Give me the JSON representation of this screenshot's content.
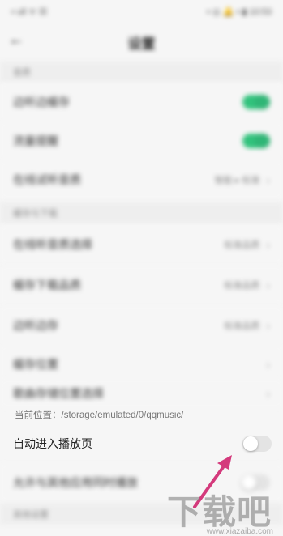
{
  "status_bar": {
    "left": "▪ ull ᯤ ☒",
    "right": "▪ ◎ 🔔 ▪ ▮ 10:53"
  },
  "header": {
    "title": "设置",
    "back_label": "←"
  },
  "sections": [
    {
      "label": "音质"
    },
    {
      "label": "缓存与下载"
    },
    {
      "label": "其他设置"
    }
  ],
  "rows": [
    {
      "label": "边听边缓存",
      "control": "toggle-on"
    },
    {
      "label": "流量提醒",
      "control": "toggle-on"
    },
    {
      "label": "在线试听音质",
      "value": "智能 ▸ 标准"
    },
    {
      "label": "在线听音质选择",
      "value": "标准品质"
    },
    {
      "label": "缓存下载品质",
      "value": "标准品质"
    },
    {
      "label": "边听边存",
      "value": "标准品质"
    },
    {
      "label": "缓存位置"
    },
    {
      "label": "歌曲存储位置选择"
    },
    {
      "label": "自动进入播放页",
      "control": "toggle-off"
    },
    {
      "label": "允许与其他应用同时播放",
      "control": "toggle-off"
    }
  ],
  "storage_path": "当前位置：/storage/emulated/0/qqmusic/",
  "watermark": {
    "main": "下载吧",
    "sub": "www.xiazaiba.com"
  },
  "colors": {
    "accent": "#31c27c",
    "arrow": "#d43a7c"
  }
}
